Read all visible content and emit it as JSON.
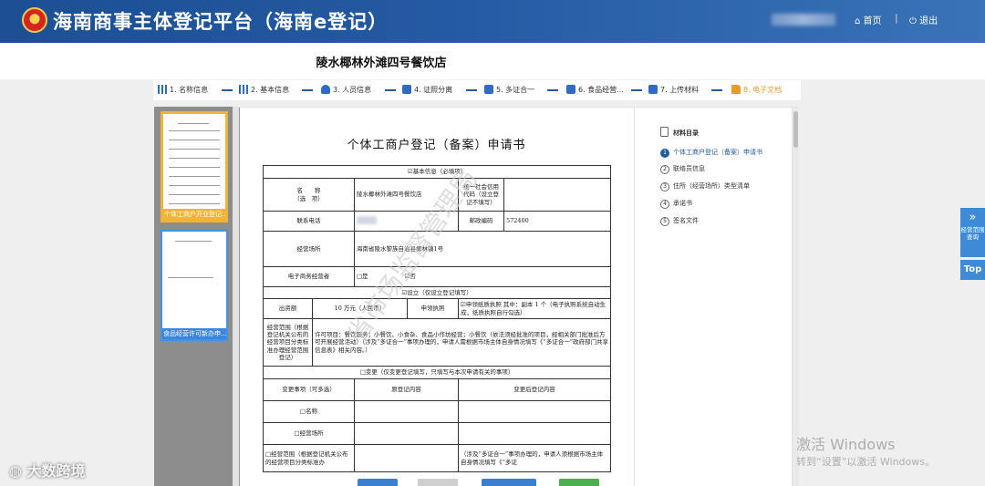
{
  "header": {
    "title": "海南商事主体登记平台（海南e登记）",
    "home_label": "首页",
    "separator": "|",
    "logout_label": "退出"
  },
  "store_name": "陵水椰林外滩四号餐饮店",
  "steps": [
    {
      "label": "1. 名称信息",
      "icon": "bars-icon"
    },
    {
      "label": "2. 基本信息",
      "icon": "bars-icon"
    },
    {
      "label": "3. 人员信息",
      "icon": "person-icon"
    },
    {
      "label": "4. 证照分离",
      "icon": "doc-icon"
    },
    {
      "label": "5. 多证合一",
      "icon": "doc-icon"
    },
    {
      "label": "6. 食品经营...",
      "icon": "doc-icon"
    },
    {
      "label": "7. 上传材料",
      "icon": "upload-icon"
    },
    {
      "label": "8. 电子文档",
      "icon": "folder-icon",
      "active": true
    }
  ],
  "thumbnails": [
    {
      "label": "个体工商户开业登记..."
    },
    {
      "label": "食品经营许可新办申..."
    }
  ],
  "directory": {
    "title": "材料目录",
    "items": [
      {
        "num": "1",
        "label": "个体工商户登记（备案）申请书"
      },
      {
        "num": "2",
        "label": "联络员信息"
      },
      {
        "num": "3",
        "label": "住所（经营场所）类型清单"
      },
      {
        "num": "4",
        "label": "承诺书"
      },
      {
        "num": "5",
        "label": "签名文件"
      }
    ]
  },
  "document": {
    "title": "个体工商户登记（备案）申请书",
    "basic_section": "☑基本信息（必填项）",
    "name_label": "名　　称\n（选　项）",
    "name_value": "陵水椰林外滩四号餐饮店",
    "credit_code_label": "统一社会信用代码（设立登记不填写）",
    "phone_label": "联系电话",
    "postal_label": "邮政编码",
    "postal_value": "572400",
    "address_label": "经营场所",
    "address_value": "海南省陵水黎族自治县椰林镇1号",
    "ecommerce_label": "电子商务经营者",
    "ecommerce_no": "□是",
    "ecommerce_yes": "☑否",
    "establish_section": "☑设立（仅设立登记填写）",
    "capital_label": "出资额",
    "capital_value": "10 万元（人民币）",
    "license_label": "申领执照",
    "license_value": "☑申领纸质执照  其中：副本  1 个（电子执照系统自动生成，纸质执照自行勾选）",
    "scope_label": "经营范围（根据登记机关公布的经营项目分类标准办理经营范围登记）",
    "scope_value": "许可项目：餐饮服务；小餐饮、小食杂、食品小作坊经营；小餐饮（依法须经批准的项目，经相关部门批准后方可开展经营活动）（涉及“多证合一”事项办理的，申请人需根据市场主体自身情况填写《“多证合一”政府部门共享信息表》相关内容。）",
    "change_section": "□变更（仅变更登记填写，只填写与本次申请有关的事项）",
    "change_item_label": "变更事项（可多选）",
    "before_label": "原登记内容",
    "after_label": "变更后登记内容",
    "change_name": "□名称",
    "change_address": "□经营场所",
    "change_scope": "□经营范围（根据登记机关公布的经营项目分类标准办",
    "change_scope_note": "（涉及“多证合一”事项办理的，申请人须根据市场主体自身情况填写《“多证"
  },
  "stamp_text": "省市场监督管理局",
  "float_buttons": {
    "guide": "经营范围查询",
    "top": "Top"
  },
  "watermark": {
    "activate_title": "激活 Windows",
    "activate_sub": "转到“设置”以激活 Windows。",
    "corner": "大数跨境"
  },
  "colors": {
    "header_blue": "#245aa3",
    "accent_orange": "#e89a2e",
    "selected_border": "#f1b43a"
  }
}
